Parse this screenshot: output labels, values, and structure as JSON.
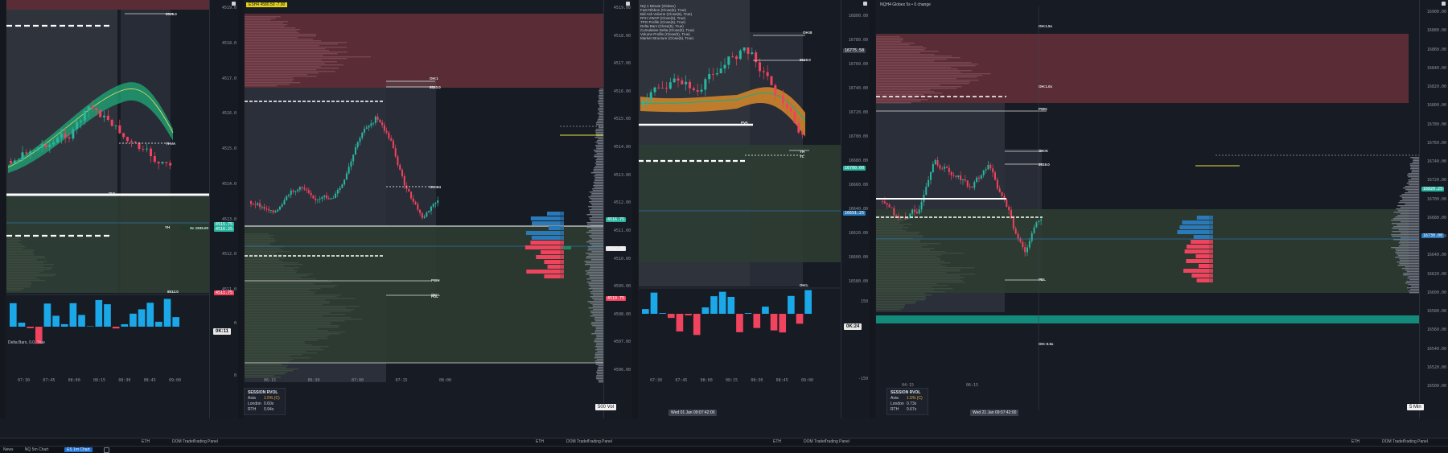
{
  "colors": {
    "bull": "#2bb5a0",
    "bear": "#f0435e",
    "delta_pos": "#1aa8e8",
    "delta_neg": "#f0435e",
    "supply_zone": "#5a2d36",
    "demand_zone": "#2c3c32",
    "background": "#171b24"
  },
  "panes": [
    {
      "id": "pane1",
      "y_ticks": [
        "4519.0",
        "4518.0",
        "4517.0",
        "4516.0",
        "4515.0",
        "4514.0",
        "4513.0",
        "4512.0",
        "4511.0"
      ],
      "x_ticks": [
        "07:30",
        "07:45",
        "08:00",
        "08:15",
        "08:30",
        "08:45",
        "09:00"
      ],
      "levels": [
        "8519.0",
        "PVA",
        "YHVA",
        "YH",
        "8512.0"
      ],
      "price_flags": [
        "4516.25",
        "4515.75",
        "4511.75"
      ],
      "order_label": "Sc 1935.00",
      "timeframe": "0K:11",
      "indicator_label": "Delta Bars, 0.0, True",
      "indicator_ticks": [
        "0",
        "0"
      ],
      "bottom_items": [
        "ETH",
        "DOM Trader",
        "Trading Panel"
      ]
    },
    {
      "id": "pane2",
      "header": "ESH4 4580.50  -7.00",
      "y_ticks": [
        "4519.00",
        "4518.00",
        "4517.00",
        "4516.00",
        "4515.00",
        "4514.00",
        "4513.00",
        "4512.00",
        "4511.00",
        "4510.00",
        "4509.00",
        "4508.00",
        "4507.00",
        "4506.00"
      ],
      "x_ticks": [
        "06:15",
        "06:30",
        "07:00",
        "07:15",
        "08:00"
      ],
      "levels": [
        "OH:1",
        "8520.0",
        "OH:B4",
        "PWH",
        "OH:L",
        "PDL"
      ],
      "price_flags": [
        "4516.75",
        "4512.75",
        "4510.75"
      ],
      "session_box": {
        "title": "SESSION RVOL",
        "rows": [
          {
            "name": "Asia",
            "value": "1.5% (C)"
          },
          {
            "name": "London",
            "value": "0.60x"
          },
          {
            "name": "RTH",
            "value": "0.94x"
          }
        ]
      },
      "volume_badge": "500 Vol",
      "bottom_items": [
        "ETH",
        "DOM Trader",
        "Trading Panel"
      ]
    },
    {
      "id": "pane3",
      "legend": [
        "NQ 1 Minute (Globex)",
        "Fast Ribbon (Close(5), True)",
        "Bid Ask Volume (Close(5), True)",
        "RTH VWAP (Close(5), True)",
        "TPO Profile (Close(5), True)",
        "Delta Bars (Close(5), True)",
        "Cumulative Delta (Close(5), True)",
        "Volume Profile (Close(5), True)",
        "Market Structure (Close(5), True)"
      ],
      "y_ticks": [
        "16800.00",
        "16780.00",
        "16760.00",
        "16740.00",
        "16720.00",
        "16700.00",
        "16680.00",
        "16660.00",
        "16640.00",
        "16620.00",
        "16600.00",
        "16580.00"
      ],
      "x_ticks": [
        "07:30",
        "07:45",
        "08:00",
        "08:15",
        "08:30",
        "08:45",
        "09:00"
      ],
      "levels": [
        "OH:B",
        "8519.0",
        "PVA",
        "YH",
        "YL",
        "OH:L"
      ],
      "price_flags": [
        "16775.50",
        "16700.00",
        "16691.25"
      ],
      "timeframe": "0K:24",
      "crosshair_time": "Wed 01 Jan 09:07:42:00",
      "indicator_ticks": [
        "150",
        "-150"
      ],
      "bottom_items": [
        "ETH",
        "DOM Trader",
        "Trading Panel"
      ]
    },
    {
      "id": "pane4",
      "header": "NQH4 Globex 5s • 0 change",
      "y_ticks": [
        "16900.00",
        "16880.00",
        "16860.00",
        "16840.00",
        "16820.00",
        "16800.00",
        "16780.00",
        "16760.00",
        "16740.00",
        "16720.00",
        "16700.00",
        "16680.00",
        "16660.00",
        "16640.00",
        "16620.00",
        "16600.00",
        "16580.00",
        "16560.00",
        "16540.00",
        "16520.00",
        "16500.00"
      ],
      "x_ticks": [
        "04:15",
        "06:15"
      ],
      "levels": [
        "OH:1.5x",
        "OH:1.0x",
        "PWH",
        "OH:N",
        "8519.0",
        "PDL",
        "OH:-0.5x"
      ],
      "price_flags": [
        "16820.25",
        "16730.00"
      ],
      "session_box": {
        "title": "SESSION RVOL",
        "rows": [
          {
            "name": "Asia",
            "value": "1.5% (C)"
          },
          {
            "name": "London",
            "value": "0.73x"
          },
          {
            "name": "RTH",
            "value": "0.67x"
          }
        ]
      },
      "crosshair_time": "Wed 21 Jan 09:07:42:00",
      "volume_badge": "5 Min",
      "bottom_items": [
        "ETH",
        "DOM Trader",
        "Trading Panel"
      ]
    }
  ],
  "taskbar": {
    "items": [
      "News",
      "NQ 5m Chart",
      "ES 1m Chart"
    ],
    "active_index": 2
  }
}
